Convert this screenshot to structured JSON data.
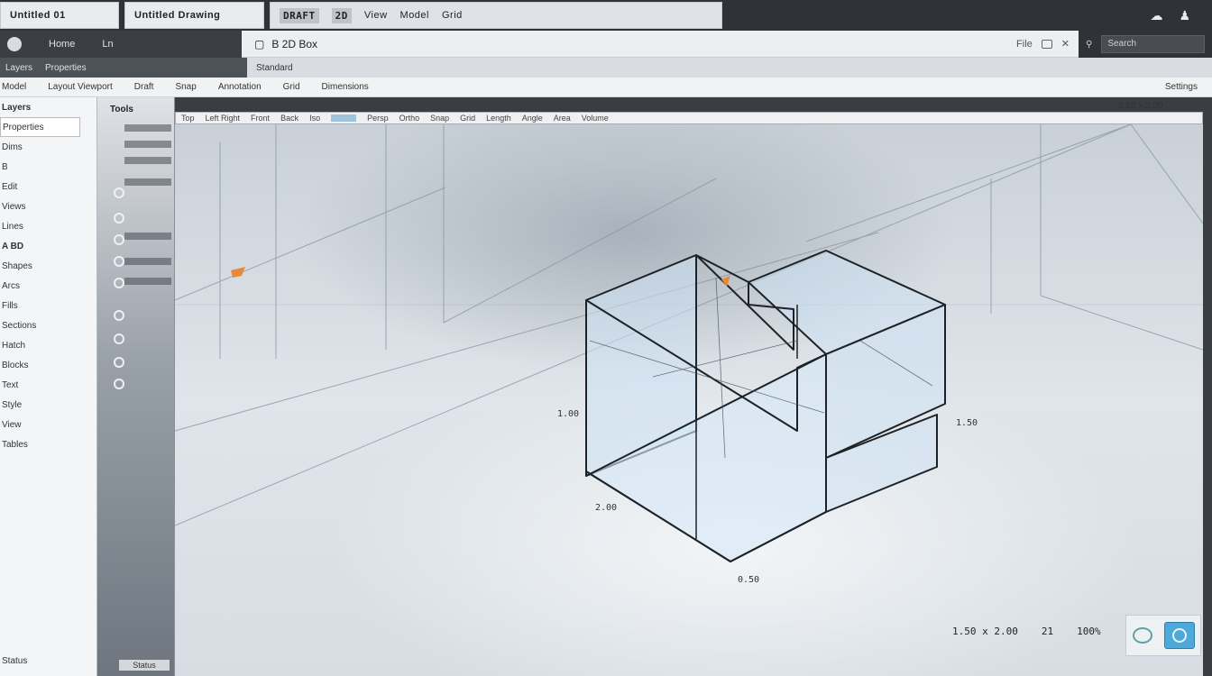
{
  "tabs": [
    {
      "label": "Untitled 01"
    },
    {
      "label": "Untitled Drawing"
    }
  ],
  "tab_toolbar": {
    "chip_a": "DRAFT",
    "chip_b": "2D",
    "item_view": "View",
    "item_model": "Model",
    "item_grid": "Grid"
  },
  "rail": {
    "label_a": "Home",
    "label_b": "Ln"
  },
  "document": {
    "title": "B 2D Box"
  },
  "header_right": {
    "label": "File"
  },
  "search": {
    "placeholder": "Search"
  },
  "toolbar": {
    "left_label": "Layers",
    "mid_label": "Properties",
    "light_label": "Standard"
  },
  "ribbon": {
    "items": [
      "Model",
      "Layout Viewport",
      "Draft",
      "Snap",
      "Annotation",
      "Grid",
      "Dimensions"
    ],
    "right": "Settings"
  },
  "left_panel": {
    "items": [
      "Layers",
      "Properties",
      "Dims",
      "B",
      "Edit",
      "Views",
      "Lines",
      "A BD",
      "Shapes",
      "Arcs",
      "Fills",
      "Sections",
      "Hatch",
      "Blocks",
      "Text",
      "Style",
      "View",
      "Tables"
    ],
    "footer": "Status"
  },
  "tool_column": {
    "header": "Tools",
    "footer": "Status"
  },
  "ruler": {
    "items": [
      "Top",
      "Left Right",
      "Front",
      "Back",
      "Iso",
      "Persp",
      "Ortho",
      "Snap",
      "Grid",
      "Length",
      "Angle",
      "Area",
      "Volume"
    ]
  },
  "coords_readout": "2.50 x 2.00",
  "viewport_labels": {
    "dim_a": "1.00",
    "dim_b": "2.00",
    "dim_c": "0.50",
    "dim_d": "1.50"
  },
  "status": {
    "left": "1.50 x 2.00",
    "mid": "21",
    "right": "100%"
  },
  "colors": {
    "accent": "#4fa9d8",
    "marker": "#e8893a"
  },
  "icons": [
    "logo-icon",
    "cloud-icon",
    "user-icon",
    "orbit-icon",
    "navigation-icon"
  ]
}
